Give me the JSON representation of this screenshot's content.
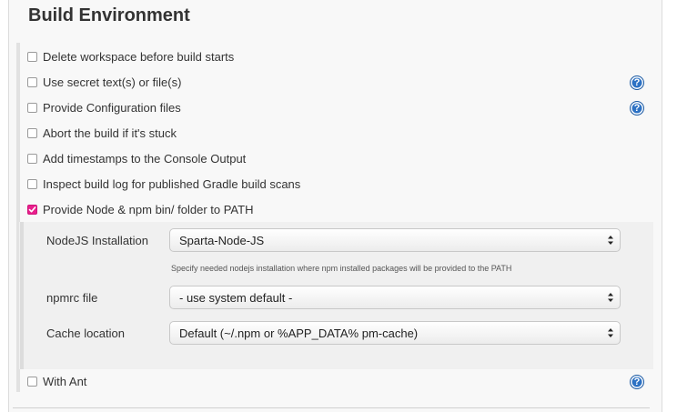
{
  "section": {
    "title": "Build Environment"
  },
  "options": [
    {
      "label": "Delete workspace before build starts",
      "checked": false,
      "help": false
    },
    {
      "label": "Use secret text(s) or file(s)",
      "checked": false,
      "help": true
    },
    {
      "label": "Provide Configuration files",
      "checked": false,
      "help": true
    },
    {
      "label": "Abort the build if it's stuck",
      "checked": false,
      "help": false
    },
    {
      "label": "Add timestamps to the Console Output",
      "checked": false,
      "help": false
    },
    {
      "label": "Inspect build log for published Gradle build scans",
      "checked": false,
      "help": false
    },
    {
      "label": "Provide Node & npm bin/ folder to PATH",
      "checked": true,
      "help": false
    }
  ],
  "node_config": {
    "nodejs_installation": {
      "label": "NodeJS Installation",
      "value": "Sparta-Node-JS",
      "hint": "Specify needed nodejs installation where npm installed packages will be provided to the PATH"
    },
    "npmrc_file": {
      "label": "npmrc file",
      "value": "- use system default -"
    },
    "cache_location": {
      "label": "Cache location",
      "value": "Default (~/.npm or %APP_DATA% pm-cache)"
    }
  },
  "with_ant": {
    "label": "With Ant",
    "checked": false,
    "help": true
  },
  "help_glyph": "?",
  "colors": {
    "checkbox_checked": "#e91e8c",
    "help_icon": "#2d72c4"
  },
  "icons": {
    "help": "question-mark-circle-icon",
    "select": "chevron-up-down-icon"
  }
}
